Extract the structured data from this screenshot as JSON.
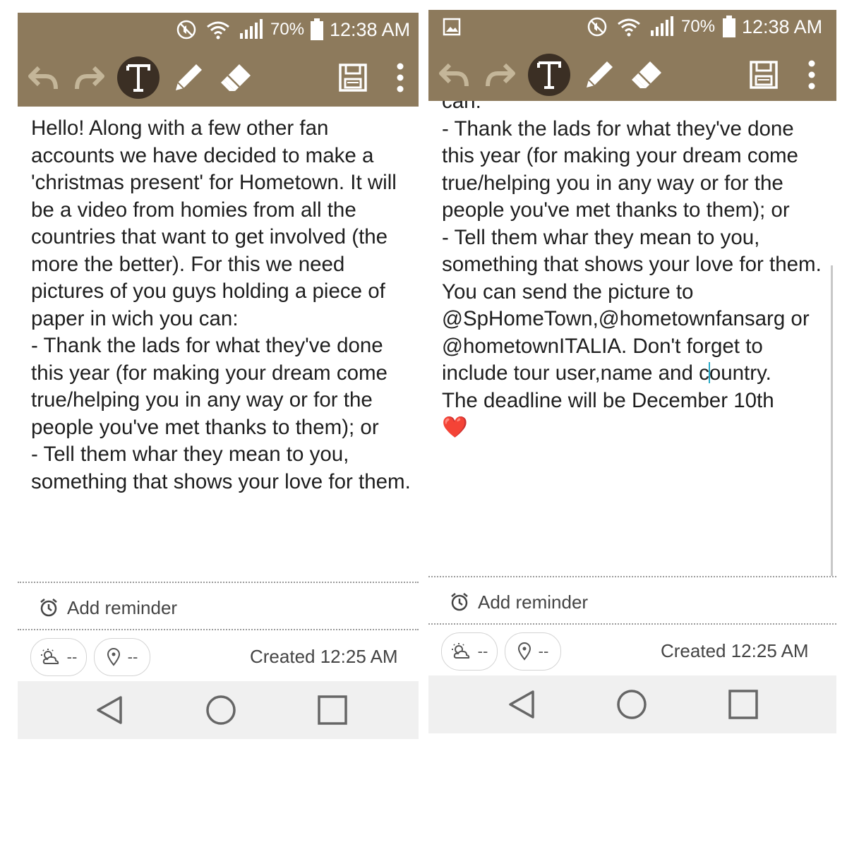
{
  "status": {
    "battery_pct": "70%",
    "time": "12:38 AM"
  },
  "note": {
    "left_paragraphs": [
      "Hello! Along with a few other fan accounts we have decided to make a 'christmas present' for Hometown. It will be a video from homies from all the countries that want to get involved (the more the better). For this we need pictures of you guys holding a piece of paper in wich you can:",
      "- Thank the lads for what they've done this year (for making your dream come true/helping you in any way or for the people you've met thanks to them); or",
      "- Tell them whar they mean to you, something that shows your love for them."
    ],
    "right_cut_top": "can:",
    "right_paragraphs": [
      "- Thank the lads for what they've done this year (for making your dream come true/helping you in any way or for the people you've met thanks to them); or",
      "- Tell them whar they mean to you, something that shows your love for them."
    ],
    "send_before_cursor": "You can send the picture to @SpHomeTown,@hometownfansarg or @hometownITALIA. Don't forget to include tour user,name and c",
    "send_after_cursor": "ountry.",
    "deadline": "The deadline will be December 10th",
    "heart": "❤️"
  },
  "footer": {
    "add_reminder": "Add reminder",
    "weather_value": "--",
    "location_value": "--",
    "created": "Created 12:25 AM"
  },
  "colors": {
    "appbar": "#8d7a5c",
    "navbar": "#f0f0f0",
    "cursor": "#27a9c6"
  },
  "icons": [
    "mute-icon",
    "wifi-icon",
    "signal-icon",
    "battery-icon",
    "undo-icon",
    "redo-icon",
    "text-mode-icon",
    "pen-icon",
    "eraser-icon",
    "save-icon",
    "more-vert-icon",
    "alarm-icon",
    "weather-icon",
    "location-pin-icon",
    "back-icon",
    "home-icon",
    "recents-icon"
  ]
}
